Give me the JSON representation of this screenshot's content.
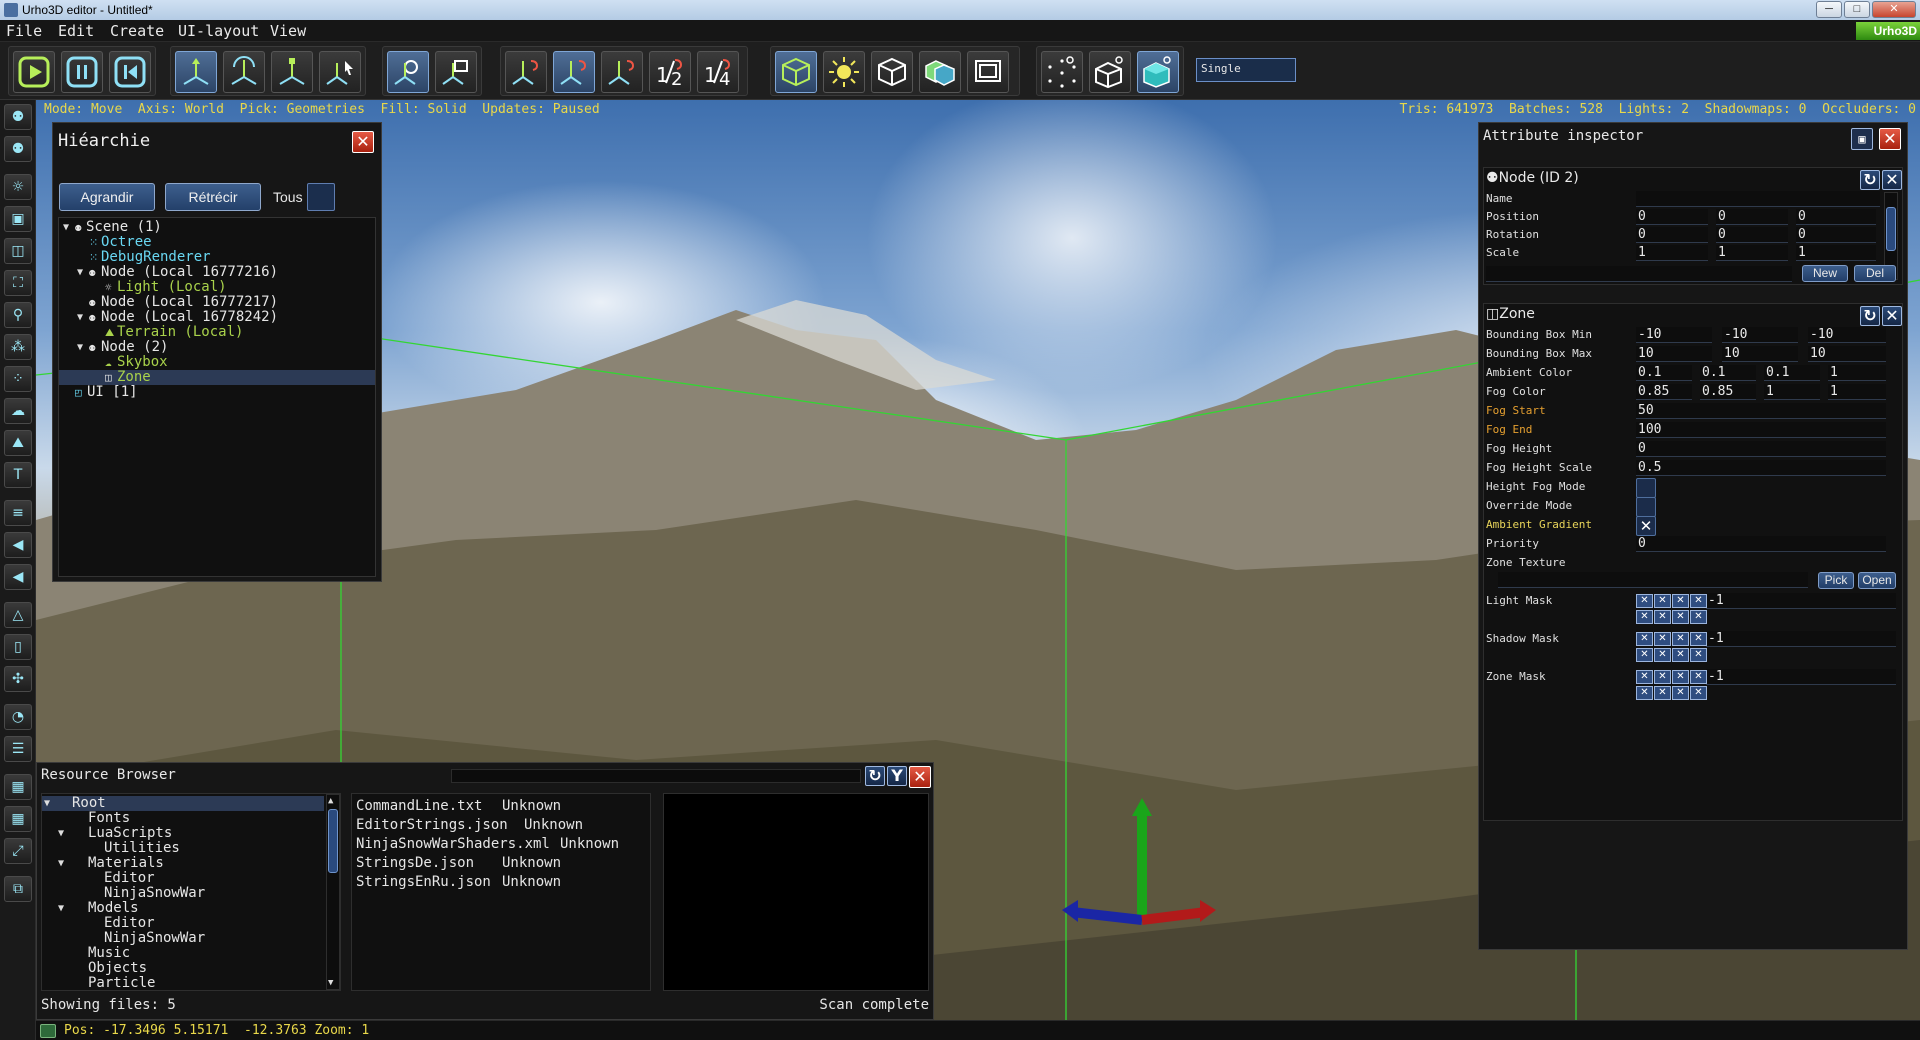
{
  "window": {
    "title": "Urho3D editor - Untitled*",
    "min_label": "─",
    "max_label": "□",
    "close_label": "✕",
    "logo": "Urho3D"
  },
  "menu": [
    "File",
    "Edit",
    "Create",
    "UI-layout",
    "View"
  ],
  "toolbar": {
    "view_mode": "Single"
  },
  "status": {
    "left": "Mode: Move  Axis: World  Pick: Geometries  Fill: Solid  Updates: Paused",
    "right": "Tris: 641973  Batches: 528  Lights: 2  Shadowmaps: 0  Occluders: 0"
  },
  "hierarchy": {
    "title": "Hiéarchie",
    "expand_label": "Agrandir",
    "collapse_label": "Rétrécir",
    "all_label": "Tous",
    "items": [
      {
        "label": "Scene (1)",
        "color": "white",
        "icon": "node-icon"
      },
      {
        "label": "Octree",
        "color": "cyan",
        "icon": "octree-icon"
      },
      {
        "label": "DebugRenderer",
        "color": "cyan",
        "icon": "debug-renderer-icon"
      },
      {
        "label": "Node (Local 16777216)",
        "color": "white",
        "icon": "node-icon"
      },
      {
        "label": "Light (Local)",
        "color": "green",
        "icon": "light-icon"
      },
      {
        "label": "Node (Local 16777217)",
        "color": "white",
        "icon": "node-icon"
      },
      {
        "label": "Node (Local 16778242)",
        "color": "white",
        "icon": "node-icon"
      },
      {
        "label": "Terrain (Local)",
        "color": "green",
        "icon": "terrain-icon"
      },
      {
        "label": "Node (2)",
        "color": "white",
        "icon": "node-icon"
      },
      {
        "label": "Skybox",
        "color": "green",
        "icon": "skybox-icon"
      },
      {
        "label": "Zone",
        "color": "green",
        "icon": "zone-icon"
      },
      {
        "label": "UI [1]",
        "color": "white",
        "icon": "ui-icon"
      }
    ]
  },
  "inspector": {
    "title": "Attribute inspector",
    "node": {
      "title": "Node (ID 2)",
      "name_label": "Name",
      "name_value": "",
      "position_label": "Position",
      "position": [
        "0",
        "0",
        "0"
      ],
      "rotation_label": "Rotation",
      "rotation": [
        "0",
        "0",
        "0"
      ],
      "scale_label": "Scale",
      "scale": [
        "1",
        "1",
        "1"
      ],
      "new_label": "New",
      "del_label": "Del"
    },
    "zone": {
      "title": "Zone",
      "bbox_min_label": "Bounding Box Min",
      "bbox_min": [
        "-10",
        "-10",
        "-10"
      ],
      "bbox_max_label": "Bounding Box Max",
      "bbox_max": [
        "10",
        "10",
        "10"
      ],
      "ambient_color_label": "Ambient Color",
      "ambient_color": [
        "0.1",
        "0.1",
        "0.1",
        "1"
      ],
      "fog_color_label": "Fog Color",
      "fog_color": [
        "0.85",
        "0.85",
        "1",
        "1"
      ],
      "fog_start_label": "Fog Start",
      "fog_start": "50",
      "fog_end_label": "Fog End",
      "fog_end": "100",
      "fog_height_label": "Fog Height",
      "fog_height": "0",
      "fog_height_scale_label": "Fog Height Scale",
      "fog_height_scale": "0.5",
      "height_fog_mode_label": "Height Fog Mode",
      "override_mode_label": "Override Mode",
      "ambient_gradient_label": "Ambient Gradient",
      "priority_label": "Priority",
      "priority": "0",
      "zone_texture_label": "Zone Texture",
      "pick_label": "Pick",
      "open_label": "Open",
      "light_mask_label": "Light Mask",
      "shadow_mask_label": "Shadow Mask",
      "zone_mask_label": "Zone Mask",
      "mask_value": "-1"
    }
  },
  "resources": {
    "title": "Resource Browser",
    "tree": [
      {
        "label": "Root",
        "depth": 0,
        "exp": "▼"
      },
      {
        "label": "Fonts",
        "depth": 1,
        "exp": ""
      },
      {
        "label": "LuaScripts",
        "depth": 1,
        "exp": "▼"
      },
      {
        "label": "Utilities",
        "depth": 2,
        "exp": ""
      },
      {
        "label": "Materials",
        "depth": 1,
        "exp": "▼"
      },
      {
        "label": "Editor",
        "depth": 2,
        "exp": ""
      },
      {
        "label": "NinjaSnowWar",
        "depth": 2,
        "exp": ""
      },
      {
        "label": "Models",
        "depth": 1,
        "exp": "▼"
      },
      {
        "label": "Editor",
        "depth": 2,
        "exp": ""
      },
      {
        "label": "NinjaSnowWar",
        "depth": 2,
        "exp": ""
      },
      {
        "label": "Music",
        "depth": 1,
        "exp": ""
      },
      {
        "label": "Objects",
        "depth": 1,
        "exp": ""
      },
      {
        "label": "Particle",
        "depth": 1,
        "exp": ""
      }
    ],
    "files": [
      {
        "name": "CommandLine.txt",
        "type": "Unknown"
      },
      {
        "name": "EditorStrings.json",
        "type": "Unknown"
      },
      {
        "name": "NinjaSnowWarShaders.xml",
        "type": "Unknown"
      },
      {
        "name": "StringsDe.json",
        "type": "Unknown"
      },
      {
        "name": "StringsEnRu.json",
        "type": "Unknown"
      }
    ],
    "count_label": "Showing files: 5",
    "status": "Scan complete"
  },
  "bottom": {
    "pos": "Pos: -17.3496 5.15171  -12.3763 Zoom: 1"
  }
}
